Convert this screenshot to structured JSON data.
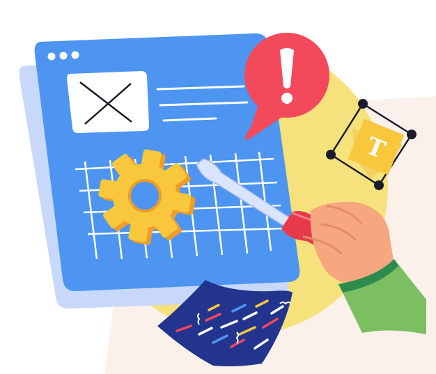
{
  "illustration": {
    "icons": [
      "browser-window-icon",
      "image-placeholder-icon",
      "gear-icon",
      "screwdriver-icon",
      "hand-icon",
      "alert-bubble-icon",
      "text-tool-icon",
      "code-sheet-icon"
    ],
    "text_tool_glyph": "T",
    "colors": {
      "background_blob": "#F5E27C",
      "background_shape": "#FBF1EA",
      "window_blue": "#4D95F0",
      "window_shadow": "#C8D8FB",
      "gear_yellow": "#F9C73C",
      "gear_orange": "#EE9C2A",
      "alert_red": "#F2495B",
      "screwdriver_red": "#E63A4B",
      "skin": "#F6A77F",
      "sleeve_green": "#7CBF62",
      "code_sheet_navy": "#23348F",
      "outline": "#1B1B2B"
    }
  }
}
